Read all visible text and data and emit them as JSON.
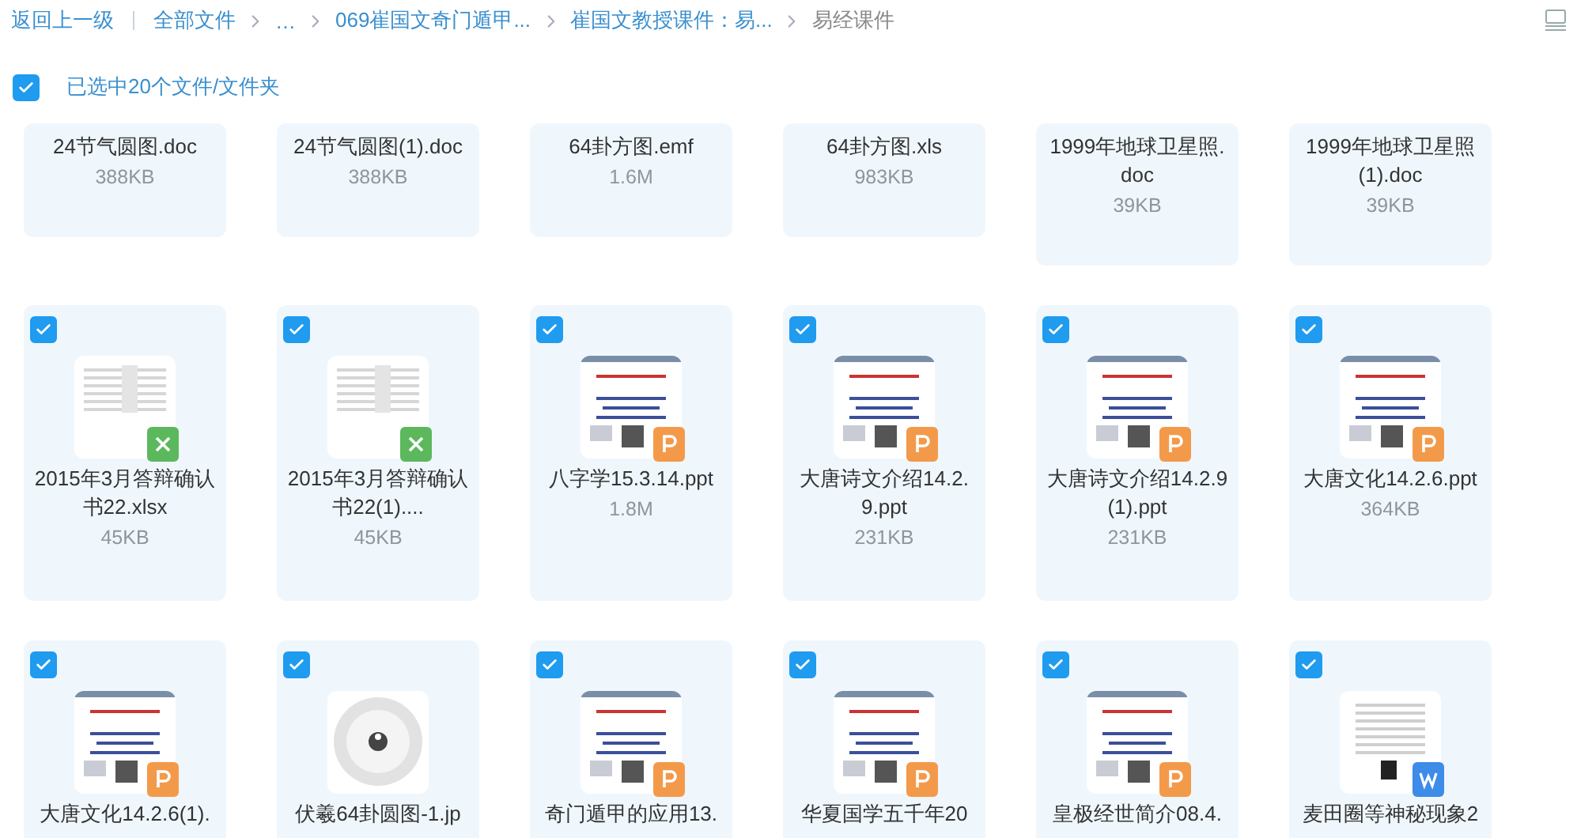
{
  "header": {
    "back": "返回上一级",
    "crumbs": [
      {
        "label": "全部文件",
        "current": false
      },
      {
        "label": "…",
        "current": false
      },
      {
        "label": "069崔国文奇门遁甲...",
        "current": false
      },
      {
        "label": "崔国文教授课件：易...",
        "current": false
      },
      {
        "label": "易经课件",
        "current": true
      }
    ]
  },
  "selection": {
    "checked": true,
    "label": "已选中20个文件/文件夹"
  },
  "rows": [
    {
      "files": [
        {
          "name": "24节气圆图.doc",
          "size": "388KB"
        },
        {
          "name": "24节气圆图(1).doc",
          "size": "388KB"
        },
        {
          "name": "64卦方图.emf",
          "size": "1.6M"
        },
        {
          "name": "64卦方图.xls",
          "size": "983KB"
        },
        {
          "name": "1999年地球卫星照.doc",
          "size": "39KB"
        },
        {
          "name": "1999年地球卫星照(1).doc",
          "size": "39KB"
        }
      ]
    },
    {
      "files": [
        {
          "name": "2015年3月答辩确认书22.xlsx",
          "size": "45KB",
          "selected": true,
          "kind": "xlsx"
        },
        {
          "name": "2015年3月答辩确认书22(1)....",
          "size": "45KB",
          "selected": true,
          "kind": "xlsx"
        },
        {
          "name": "八字学15.3.14.ppt",
          "size": "1.8M",
          "selected": true,
          "kind": "ppt"
        },
        {
          "name": "大唐诗文介绍14.2.9.ppt",
          "size": "231KB",
          "selected": true,
          "kind": "ppt"
        },
        {
          "name": "大唐诗文介绍14.2.9(1).ppt",
          "size": "231KB",
          "selected": true,
          "kind": "ppt"
        },
        {
          "name": "大唐文化14.2.6.ppt",
          "size": "364KB",
          "selected": true,
          "kind": "ppt"
        }
      ]
    },
    {
      "files": [
        {
          "name": "大唐文化14.2.6(1).",
          "selected": true,
          "kind": "ppt"
        },
        {
          "name": "伏羲64卦圆图-1.jp",
          "selected": true
        },
        {
          "name": "奇门遁甲的应用13.",
          "selected": true,
          "kind": "ppt"
        },
        {
          "name": "华夏国学五千年20",
          "selected": true,
          "kind": "ppt"
        },
        {
          "name": "皇极经世简介08.4.",
          "selected": true,
          "kind": "ppt"
        },
        {
          "name": "麦田圈等神秘现象2",
          "selected": true,
          "kind": "doc"
        }
      ]
    }
  ]
}
